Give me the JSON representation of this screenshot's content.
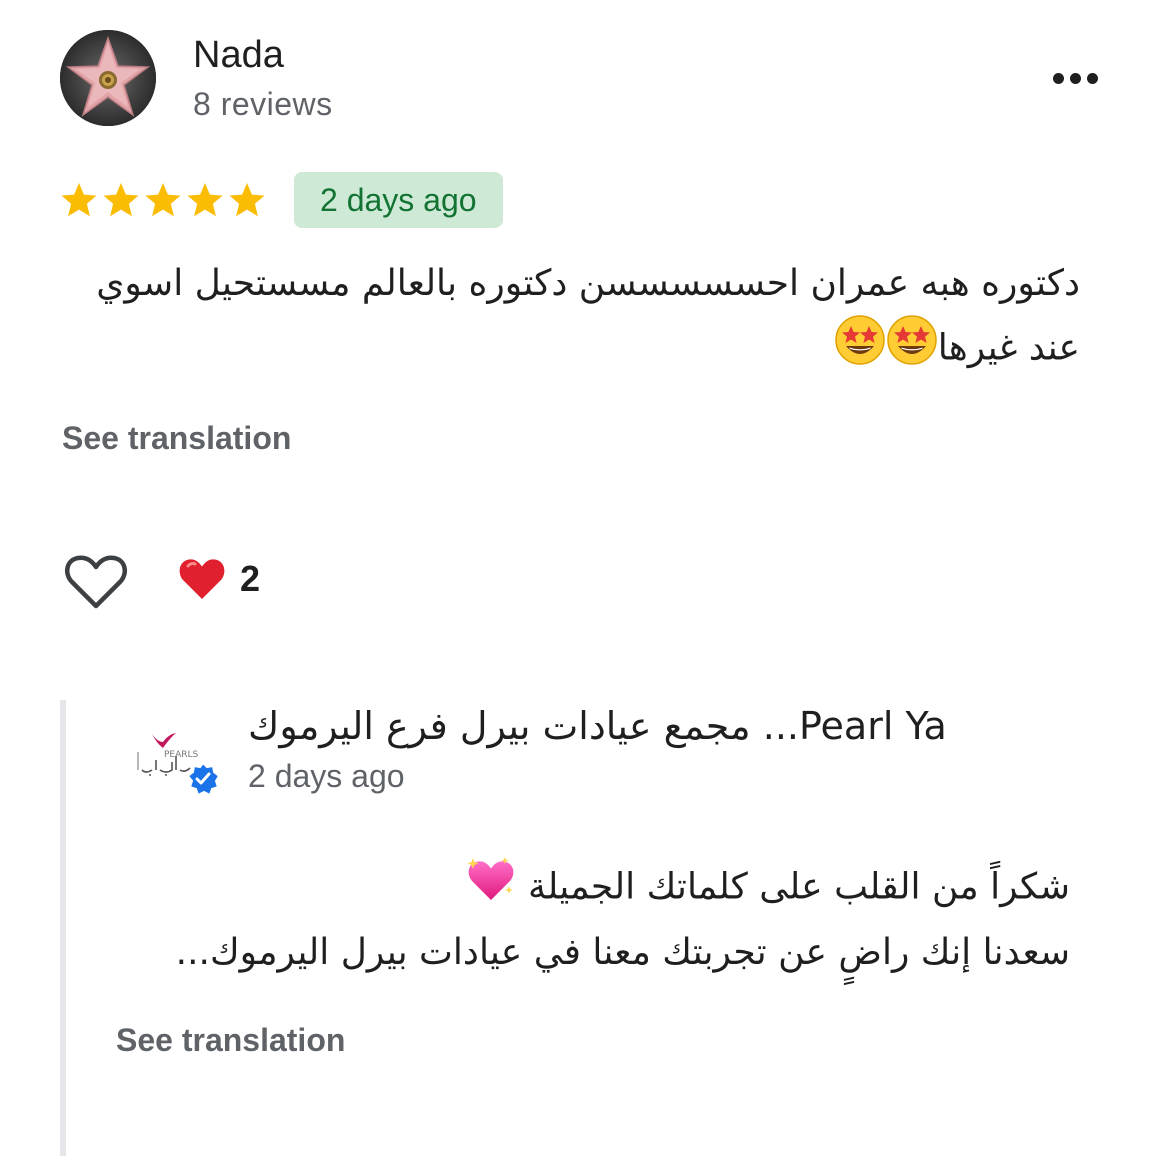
{
  "review": {
    "reviewer_name": "Nada",
    "reviewer_meta": "8 reviews",
    "rating": 5,
    "rating_max": 5,
    "date": "2 days ago",
    "text_line1": "دكتوره هبه عمران احسسسسسن دكتوره بالعالم مسستحيل اسوي",
    "text_line2": "عند غيرها",
    "text_line2_emoji": "star-struck-emoji",
    "see_translation": "See translation",
    "like_icon": "heart-outline-icon",
    "reaction_icon": "red-heart-icon",
    "reaction_count": "2"
  },
  "reply": {
    "owner_name": "مجمع عيادات بيرل فرع اليرموك ...Pearl Ya",
    "date": "2 days ago",
    "text_line1": "شكراً من القلب على كلماتك الجميلة",
    "text_line1_emoji": "sparkling-heart-emoji",
    "text_line2": "سعدنا إنك راضٍ عن تجربتك معنا في عيادات بيرل اليرموك...",
    "see_translation": "See translation",
    "logo_text": "PEARLS بيرل",
    "badge_icon": "verified-check-icon"
  },
  "colors": {
    "star": "#fbbc04",
    "date_badge_bg": "#ceead6",
    "date_badge_text": "#137333",
    "secondary_text": "#5f6368",
    "verified_blue": "#1a73e8",
    "brand_pink": "#c2185b"
  }
}
